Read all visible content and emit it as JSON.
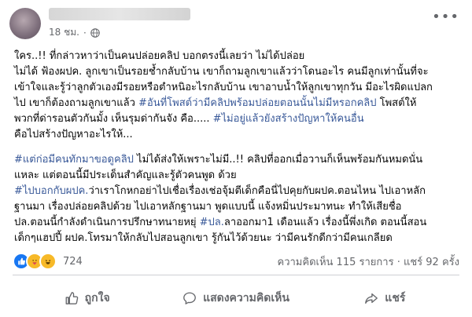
{
  "post": {
    "time": "18 ชม.",
    "more_icon": "ellipsis-icon",
    "paragraphs": [
      {
        "lines": [
          [
            {
              "text": "ใคร..!! ที่กล่าวหาว่าเป็นคนปล่อยคลิป บอกตรงนี้เลยว่า ไม่ได้ปล่อย"
            }
          ],
          [
            {
              "text": "ไม่ได้ ฟ้องผปค. ลูกเขาเป็นรอยช้ำกลับบ้าน เขาก็ถามลูกเขาแล้วว่าโดนอะไร คนมีลูกเท่านั้นที่จะ"
            }
          ],
          [
            {
              "text": "เข้าใจและรู้ว่าลูกตัวเองมีรอยหรือตำหนิอะไรกลับบ้าน เขาอาบน้ำให้ลูกเขาทุกวัน มีอะไรผิดแปลก"
            }
          ],
          [
            {
              "text": "ไป เขาก็ต้องถามลูกเขาแล้ว "
            },
            {
              "text": "#อันที่โพสต์ว่ามีคลิปพร้อมปล่อยตอนนั้นไม่มีหรอกคลิป",
              "tag": true
            },
            {
              "text": " โพสต์ให้"
            }
          ],
          [
            {
              "text": "พวกที่ด่ารอนตัวกันมั้ง  เห็นรุมด่ากันจัง คือ.....  "
            },
            {
              "text": "#ไม่อยู่แล้วยังสร้างปัญหาให้คนอื่น",
              "tag": true
            }
          ],
          [
            {
              "text": "คือไปสร้างปัญหาอะไรให้..."
            }
          ]
        ]
      },
      {
        "lines": [
          [
            {
              "text": "#แต่ก่อมีคนทักมาขอดูคลิป",
              "tag": true
            },
            {
              "text": "  ไม่ได้ส่งให้เพราะไม่มี..!! คลิปที่ออกเมื่อวานก็เห็นพร้อมกันหมดนั่น"
            }
          ],
          [
            {
              "text": "แหละ    แต่ตอนนี้มีประเด็นสำคัญและรู้ตัวคนพูด ด้วย"
            }
          ],
          [
            {
              "text": "#ไปบอกกับผปค.",
              "tag": true
            },
            {
              "text": "ว่าเราโกหกอย่าไปเชื่อเรื่องเช่อจุ้มตีเด็กคือนี่ไปคุยกับผปค.ตอนไหน ไปเอาหลัก"
            }
          ],
          [
            {
              "text": "ฐานมา เรื่องปล่อยคลิปด้วย ไปเอาหลักฐานมา   พูดแบบนี้ แจ้งหมิ่นประมาทนะ ทำให้เสียชื่อ"
            }
          ],
          [
            {
              "text": "ปล.ตอนนี้กำลังดำเนินการปรึกษาทนายหยุ่ "
            },
            {
              "text": "#ปล.",
              "tag": true
            },
            {
              "text": "ลาออกมา1 เดือนแล้ว เรื่องนี้พึ่งเกิด ตอนนี้สอน"
            }
          ],
          [
            {
              "text": "เด็กๆแฮปปี้  ผปค.โทรมาให้กลับไปสอนลูกเขา รู้กันไว้ด้วยนะ  ว่ามีคนรักดีกว่ามีคนเกลียด"
            }
          ]
        ]
      }
    ],
    "reactions": {
      "icons": [
        "like-icon",
        "care-icon",
        "haha-icon"
      ],
      "count": "724"
    },
    "comments_text": "ความคิดเห็น 115 รายการ",
    "shares_text": "แชร์ 92 ครั้ง",
    "actions": {
      "like": {
        "label": "ถูกใจ",
        "icon": "thumbs-up-icon"
      },
      "comment": {
        "label": "แสดงความคิดเห็น",
        "icon": "comment-icon"
      },
      "share": {
        "label": "แชร์",
        "icon": "share-icon"
      }
    },
    "colors": {
      "link": "#385898",
      "like_blue": "#1877f2",
      "muted": "#65676b"
    }
  }
}
